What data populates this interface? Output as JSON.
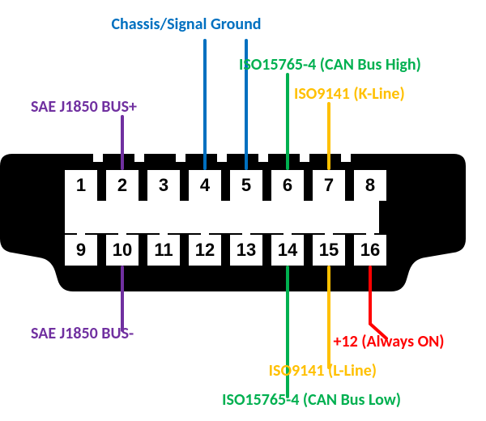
{
  "pins_top": [
    "1",
    "2",
    "3",
    "4",
    "5",
    "6",
    "7",
    "8"
  ],
  "pins_bottom": [
    "9",
    "10",
    "11",
    "12",
    "13",
    "14",
    "15",
    "16"
  ],
  "labels": {
    "chassis_ground": "Chassis/Signal Ground",
    "can_high": "ISO15765-4 (CAN Bus High)",
    "k_line": "ISO9141 (K-Line)",
    "bus_plus": "SAE J1850 BUS+",
    "bus_minus": "SAE J1850 BUS-",
    "can_low": "ISO15765-4 (CAN Bus Low)",
    "l_line": "ISO9141 (L-Line)",
    "power": "+12 (Always ON)"
  },
  "colors": {
    "purple": "#7030A0",
    "blue": "#0070C0",
    "green": "#00B050",
    "orange": "#FFC000",
    "red": "#FF0000",
    "black": "#000000"
  }
}
